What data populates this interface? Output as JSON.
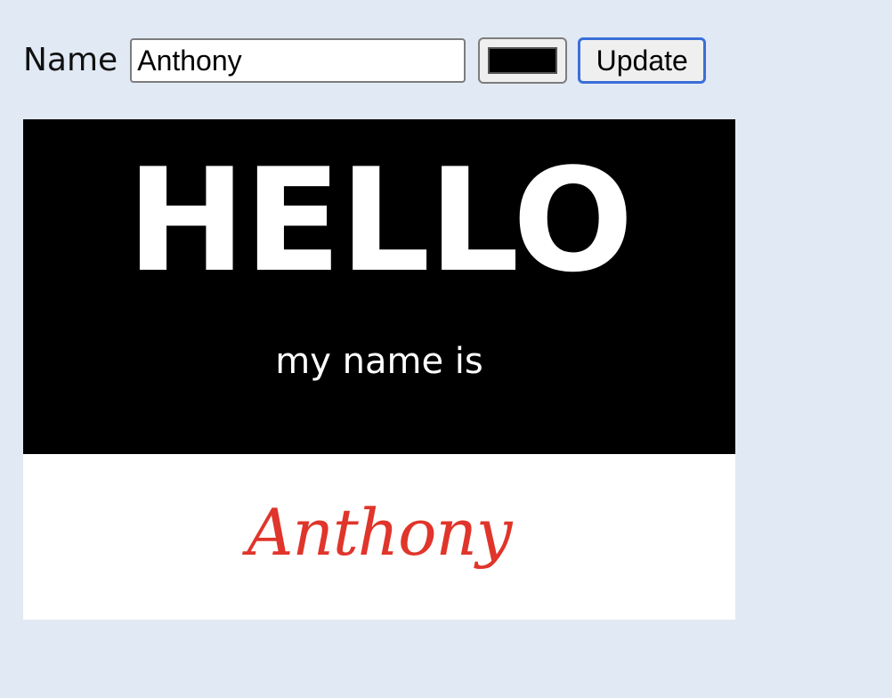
{
  "controls": {
    "name_label": "Name",
    "name_value": "Anthony",
    "color_value": "#000000",
    "update_label": "Update"
  },
  "name_tag": {
    "greeting": "HELLO",
    "subtitle": "my name is",
    "name": "Anthony",
    "header_color": "#000000",
    "name_color": "#e0352b"
  }
}
